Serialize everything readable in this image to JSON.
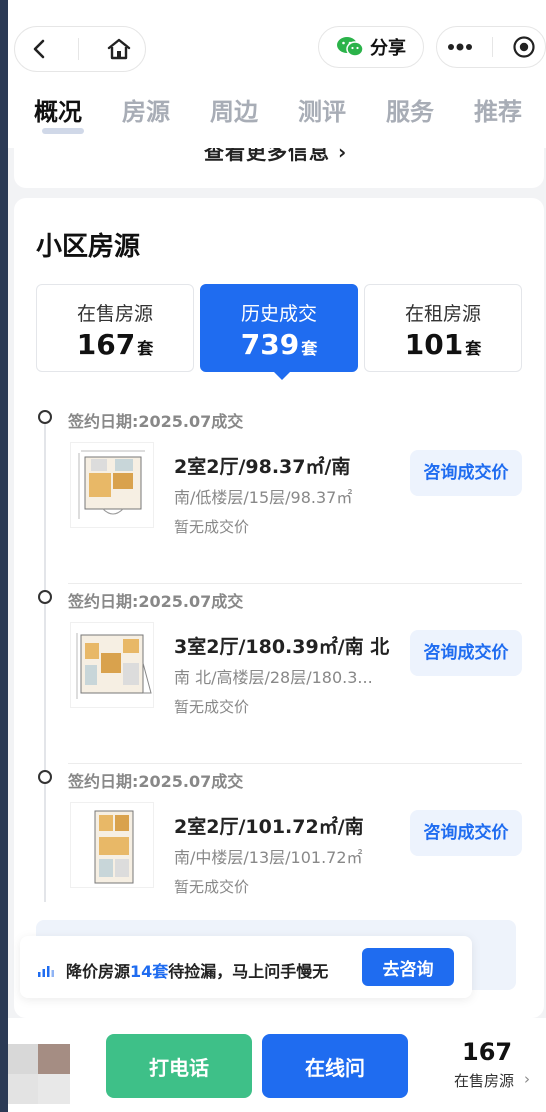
{
  "header": {
    "share_label": "分享",
    "tabs": [
      "概况",
      "房源",
      "周边",
      "测评",
      "服务",
      "推荐"
    ]
  },
  "top_card": {
    "partial_text": "查看更多信息 ›"
  },
  "listings_section": {
    "title": "小区房源",
    "stats": [
      {
        "label": "在售房源",
        "count": "167",
        "unit": "套",
        "active": false
      },
      {
        "label": "历史成交",
        "count": "739",
        "unit": "套",
        "active": true
      },
      {
        "label": "在租房源",
        "count": "101",
        "unit": "套",
        "active": false
      }
    ],
    "transactions": [
      {
        "date": "签约日期:2025.07成交",
        "layout": "2室2厅/98.37㎡/南",
        "detail": "南/低楼层/15层/98.37㎡",
        "price_note": "暂无成交价",
        "button": "咨询成交价"
      },
      {
        "date": "签约日期:2025.07成交",
        "layout": "3室2厅/180.39㎡/南 北",
        "detail": "南 北/高楼层/28层/180.3...",
        "price_note": "暂无成交价",
        "button": "咨询成交价"
      },
      {
        "date": "签约日期:2025.07成交",
        "layout": "2室2厅/101.72㎡/南",
        "detail": "南/中楼层/13层/101.72㎡",
        "price_note": "暂无成交价",
        "button": "咨询成交价"
      }
    ]
  },
  "banner": {
    "prefix": "降价房源",
    "highlight": "14套",
    "suffix": "待捡漏，马上问手慢无",
    "button": "去咨询"
  },
  "bottom_bar": {
    "call_label": "打电话",
    "online_label": "在线问",
    "count": "167",
    "count_label": "在售房源",
    "arrow": "›"
  },
  "colors": {
    "primary": "#1f6cf0",
    "call_green": "#3ec088"
  }
}
